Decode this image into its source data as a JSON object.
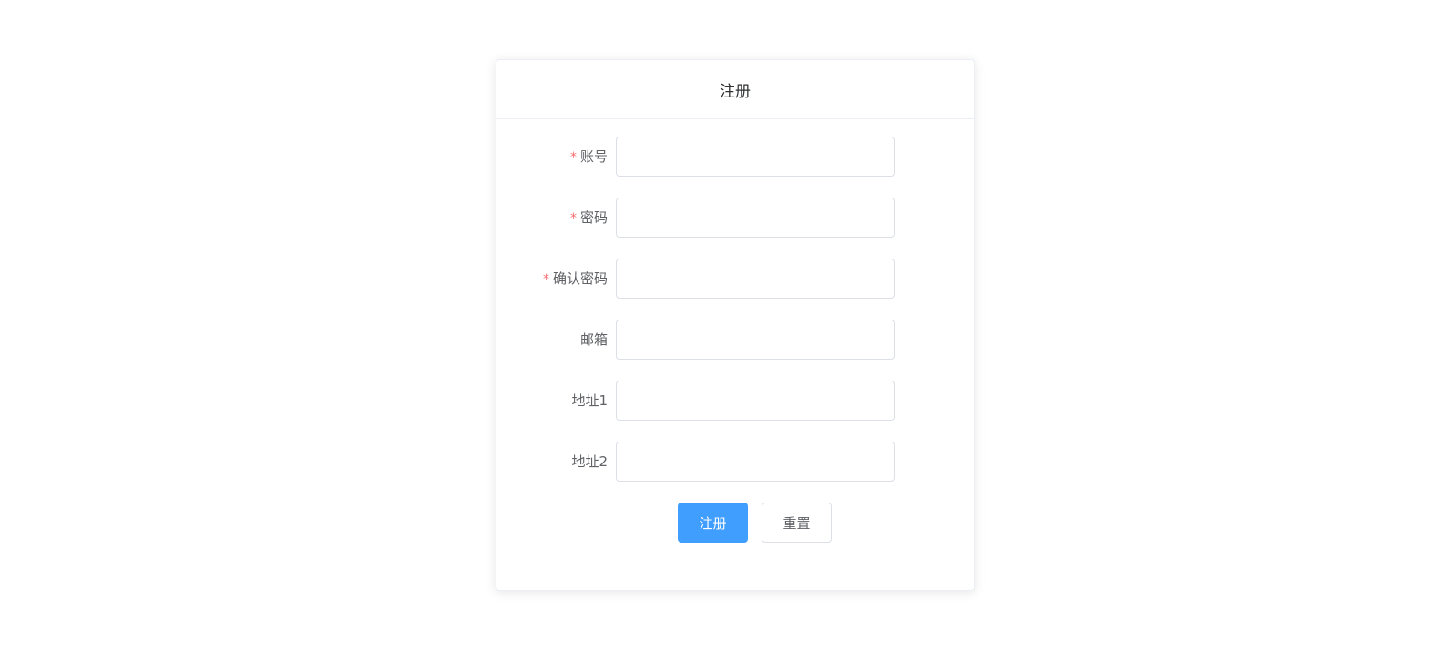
{
  "form": {
    "title": "注册",
    "required_marker": "*",
    "fields": [
      {
        "label": "账号",
        "value": "",
        "placeholder": ""
      },
      {
        "label": "密码",
        "value": "",
        "placeholder": ""
      },
      {
        "label": "确认密码",
        "value": "",
        "placeholder": ""
      },
      {
        "label": "邮箱",
        "value": "",
        "placeholder": ""
      },
      {
        "label": "地址1",
        "value": "",
        "placeholder": ""
      },
      {
        "label": "地址2",
        "value": "",
        "placeholder": ""
      }
    ],
    "submit_label": "注册",
    "reset_label": "重置"
  },
  "colors": {
    "primary": "#409eff",
    "required": "#f56c6c",
    "label": "#606266",
    "title": "#303133",
    "border": "#dcdfe6"
  }
}
